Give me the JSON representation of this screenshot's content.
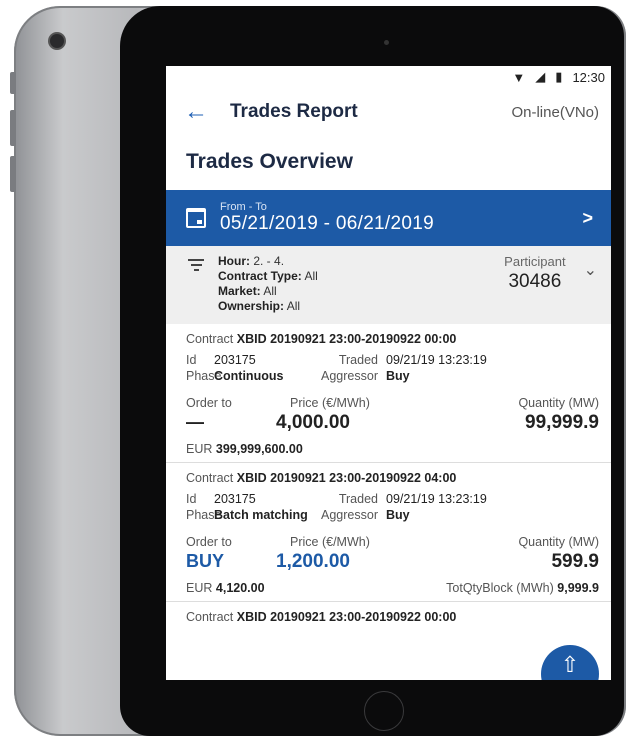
{
  "statusbar": {
    "time": "12:30"
  },
  "topbar": {
    "title": "Trades Report",
    "status": "On-line(VNo)"
  },
  "overview_title": "Trades Overview",
  "date_filter": {
    "label": "From - To",
    "range": "05/21/2019 - 06/21/2019"
  },
  "filters": {
    "hour_label": "Hour:",
    "hour_value": "2. - 4.",
    "contract_type_label": "Contract Type:",
    "contract_type_value": "All",
    "market_label": "Market:",
    "market_value": "All",
    "ownership_label": "Ownership:",
    "ownership_value": "All",
    "participant_label": "Participant",
    "participant_value": "30486"
  },
  "labels": {
    "contract": "Contract",
    "id": "Id",
    "phase": "Phase",
    "traded": "Traded",
    "aggressor": "Aggressor",
    "order_to": "Order to",
    "price": "Price (€/MWh)",
    "quantity": "Quantity (MW)",
    "eur": "EUR",
    "totqty": "TotQtyBlock (MWh)"
  },
  "trades": [
    {
      "contract": "XBID 20190921 23:00-20190922 00:00",
      "id": "203175",
      "phase": "Continuous",
      "traded": "09/21/19 13:23:19",
      "aggressor": "Buy",
      "order_to": "—",
      "price": "4,000.00",
      "quantity": "99,999.9",
      "eur": "399,999,600.00"
    },
    {
      "contract": "XBID 20190921 23:00-20190922 04:00",
      "id": "203175",
      "phase": "Batch matching",
      "traded": "09/21/19 13:23:19",
      "aggressor": "Buy",
      "order_to": "BUY",
      "price": "1,200.00",
      "quantity": "599.9",
      "eur": "4,120.00",
      "totqty": "9,999.9"
    },
    {
      "contract": "XBID 20190921 23:00-20190922 00:00"
    }
  ],
  "colors": {
    "primary": "#1d5aa6",
    "title": "#1d2a44"
  }
}
